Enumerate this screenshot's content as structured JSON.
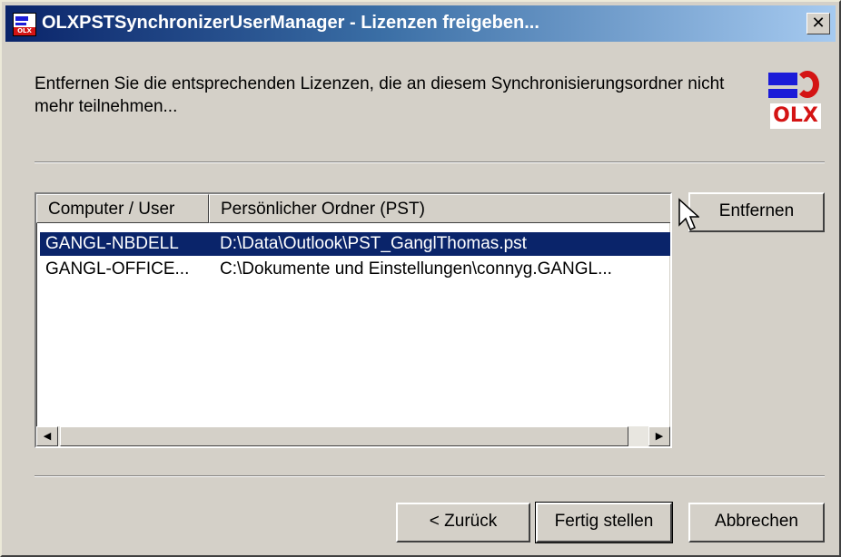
{
  "window": {
    "title": "OLXPSTSynchronizerUserManager - Lizenzen freigeben...",
    "close_label": "✕"
  },
  "instructions": "Entfernen Sie die entsprechenden Lizenzen, die an diesem Synchronisierungsordner nicht mehr teilnehmen...",
  "logo": {
    "text": "OLX",
    "brand_red": "#d41414",
    "brand_blue": "#1b1bd8"
  },
  "list": {
    "columns": [
      "Computer / User",
      "Persönlicher Ordner (PST)"
    ],
    "rows": [
      {
        "computer": "GANGL-NBDELL",
        "pst": "D:\\Data\\Outlook\\PST_GanglThomas.pst",
        "selected": true
      },
      {
        "computer": "GANGL-OFFICE...",
        "pst": "C:\\Dokumente und Einstellungen\\connyg.GANGL...",
        "selected": false
      }
    ],
    "selection_color": "#0a246a"
  },
  "buttons": {
    "remove": "Entfernen",
    "back": "< Zurück",
    "finish": "Fertig stellen",
    "cancel": "Abbrechen"
  },
  "scrollbar": {
    "left_icon": "arrow-left-icon",
    "right_icon": "arrow-right-icon"
  }
}
